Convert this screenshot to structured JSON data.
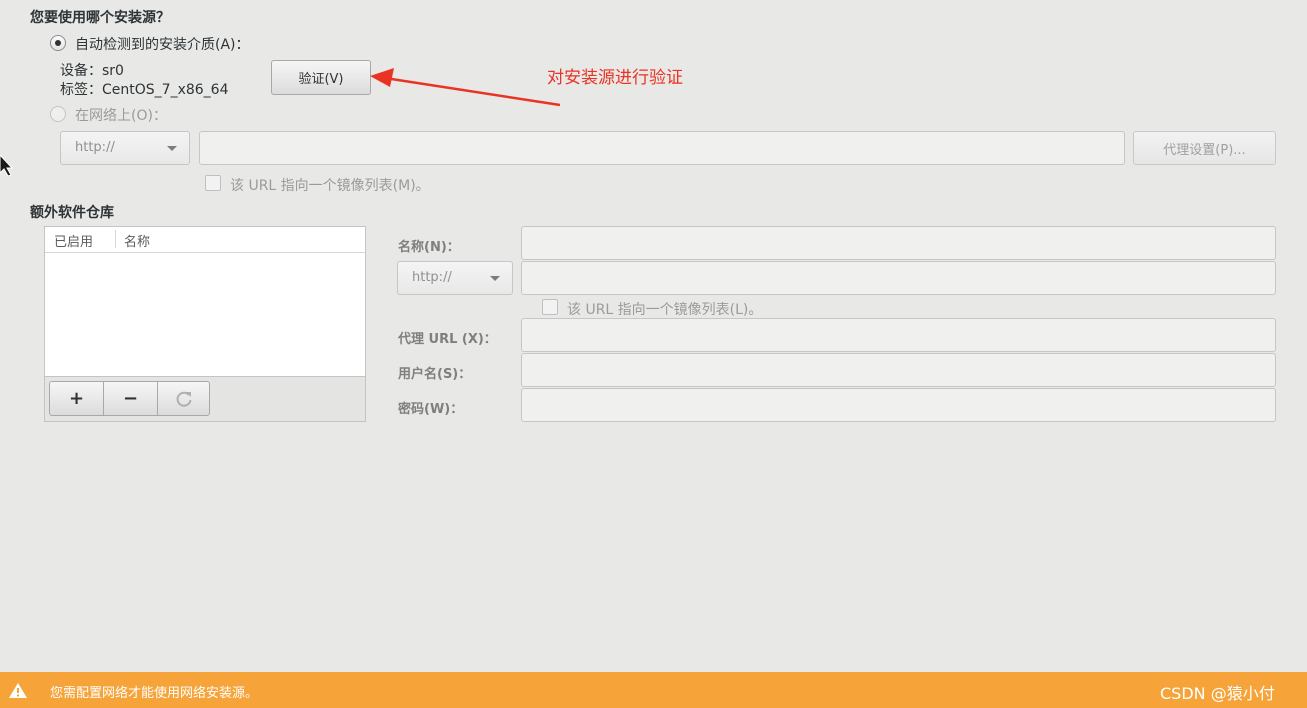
{
  "source": {
    "title": "您要使用哪个安装源？",
    "auto_media_label": "自动检测到的安装介质(A)：",
    "device_line": "设备：sr0",
    "label_line": "标签：CentOS_7_x86_64",
    "verify_button": "验证(V)",
    "network_label": "在网络上(O)：",
    "protocol": "http://",
    "proxy_button": "代理设置(P)...",
    "mirror_checkbox": "该 URL 指向一个镜像列表(M)。"
  },
  "annotation": {
    "text": "对安装源进行验证",
    "color": "#ea3323"
  },
  "repos": {
    "title": "额外软件仓库",
    "col_enabled": "已启用",
    "col_name": "名称",
    "add": "+",
    "remove": "−"
  },
  "repo_form": {
    "name_label": "名称(N)：",
    "protocol": "http://",
    "mirror_checkbox": "该 URL 指向一个镜像列表(L)。",
    "proxy_url_label": "代理 URL (X)：",
    "username_label": "用户名(S)：",
    "password_label": "密码(W)："
  },
  "warning": {
    "text": "您需配置网络才能使用网络安装源。",
    "color": "#f6a43a"
  },
  "watermark": "CSDN @猿小付"
}
